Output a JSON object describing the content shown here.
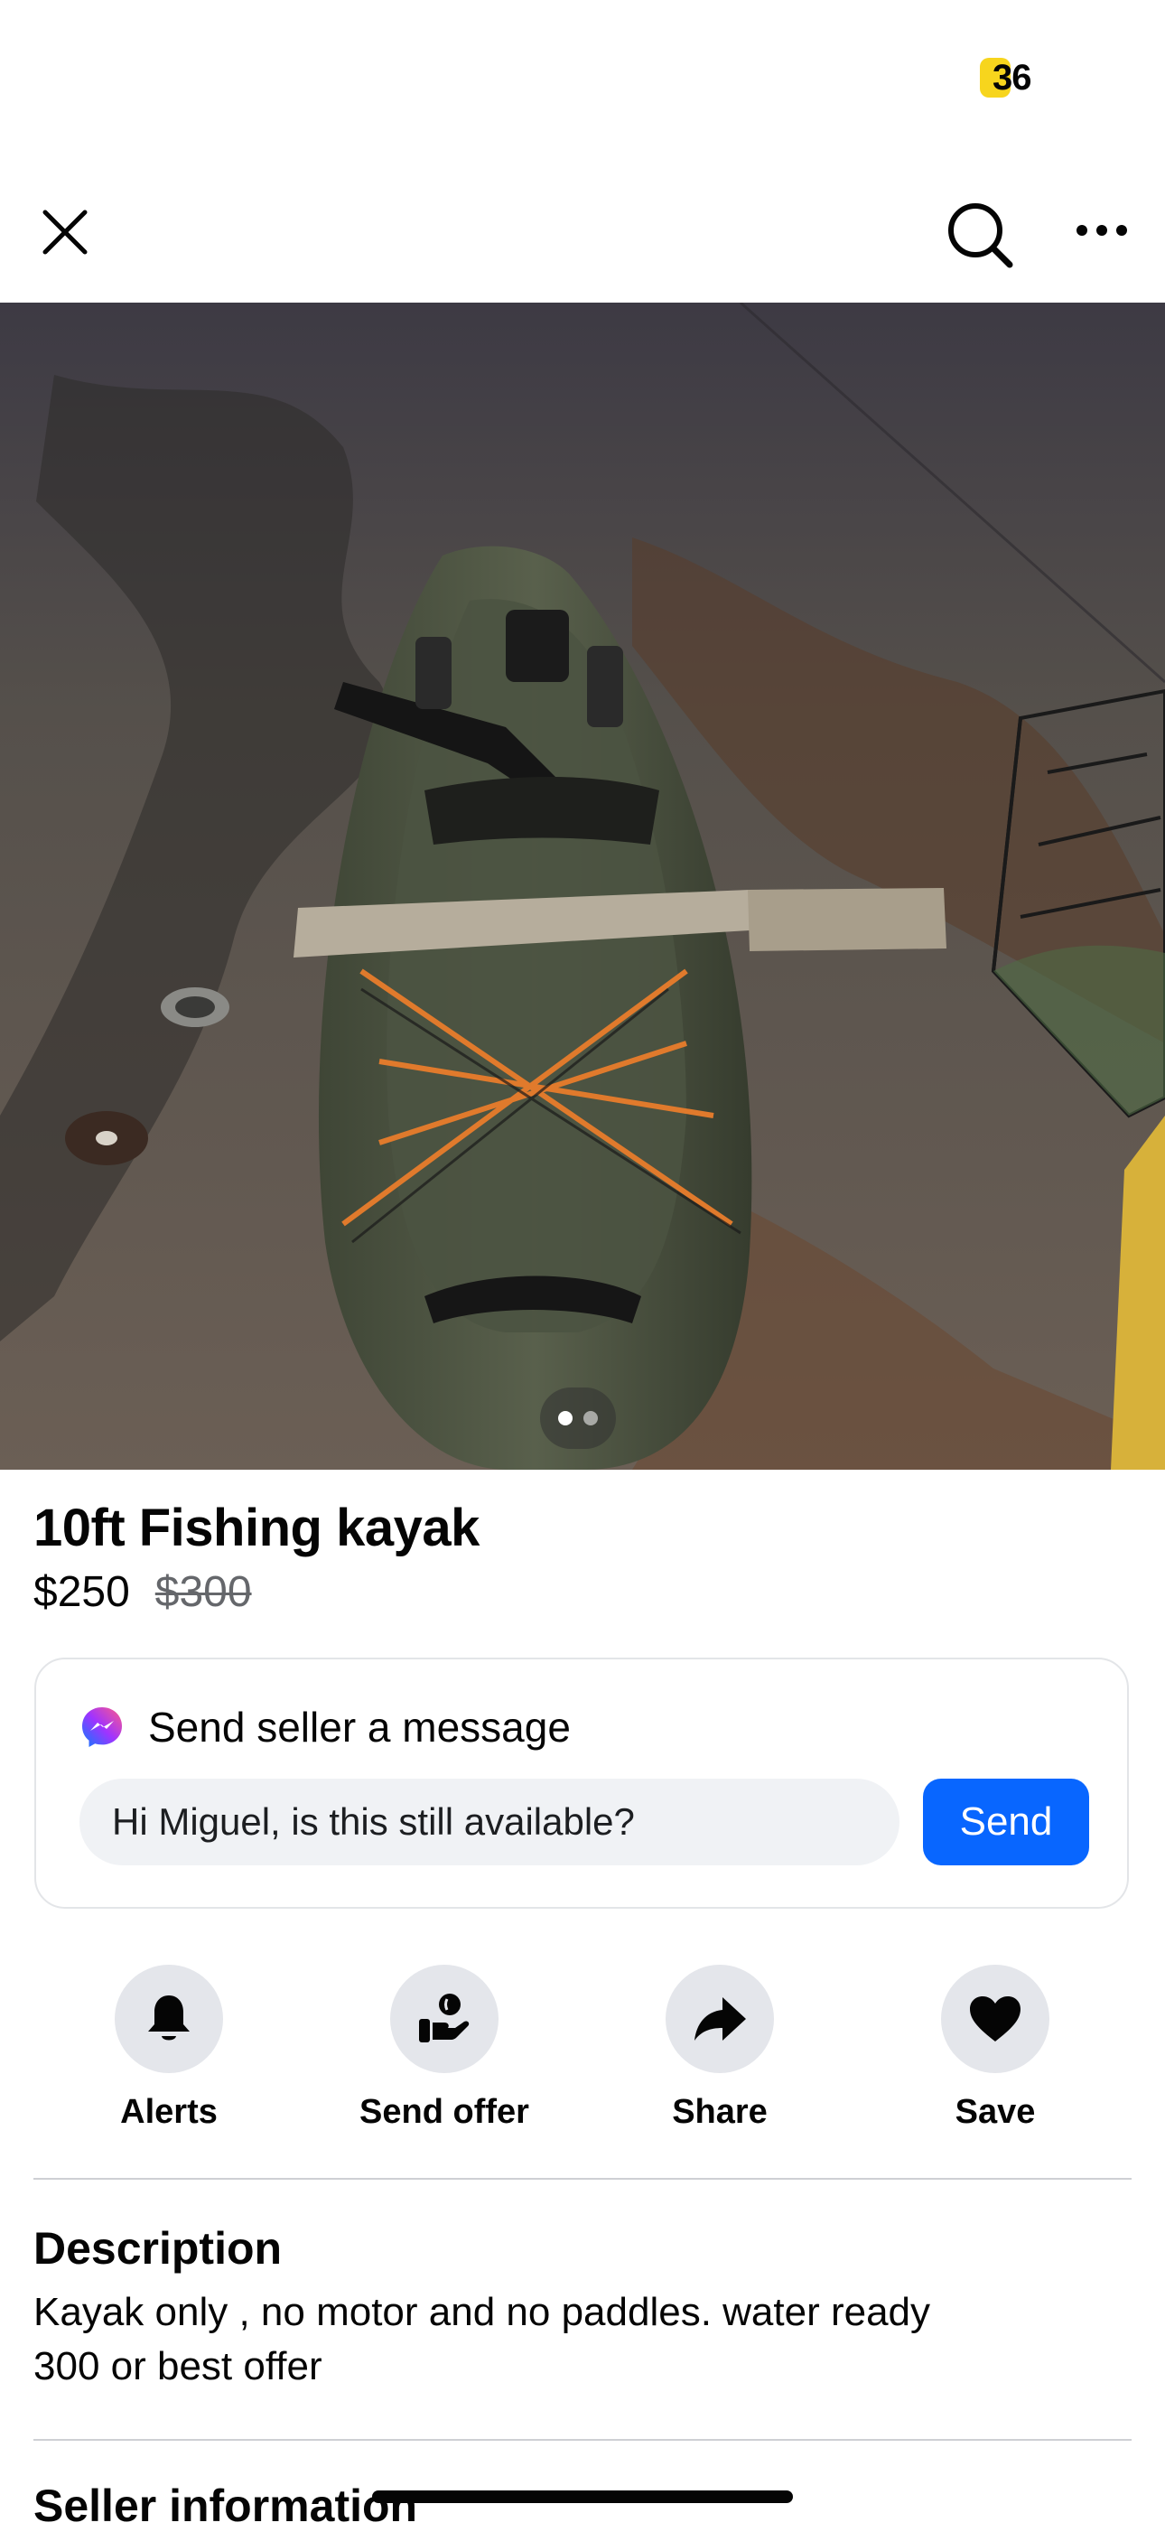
{
  "status_bar": {
    "battery": "36",
    "battery_color": "#f7d51d"
  },
  "listing": {
    "title": "10ft Fishing kayak",
    "price": "$250",
    "original_price": "$300",
    "photo_count": 2,
    "current_photo": 1
  },
  "message": {
    "header": "Send seller a message",
    "input_value": "Hi Miguel, is this still available?",
    "send_label": "Send",
    "send_color": "#0866ff"
  },
  "actions": [
    {
      "label": "Alerts",
      "icon": "bell-icon"
    },
    {
      "label": "Send offer",
      "icon": "offer-hand-icon"
    },
    {
      "label": "Share",
      "icon": "share-arrow-icon"
    },
    {
      "label": "Save",
      "icon": "heart-icon"
    }
  ],
  "description": {
    "heading": "Description",
    "text": "Kayak only , no motor and no paddles. water ready\n300 or best offer"
  },
  "seller": {
    "heading": "Seller information"
  }
}
